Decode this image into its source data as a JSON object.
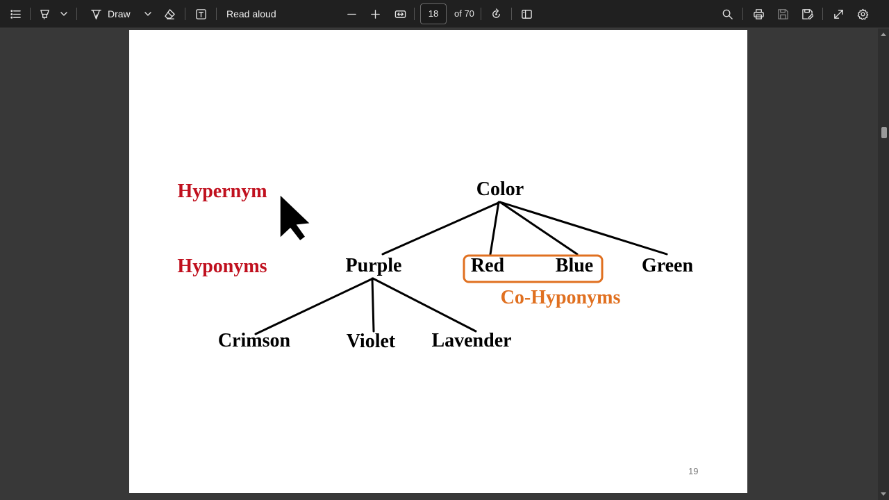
{
  "toolbar": {
    "icons": {
      "contents": "list-icon",
      "highlight": "highlighter-icon",
      "draw": "pen-icon",
      "erase": "eraser-icon",
      "text": "text-box-icon",
      "zoom_out": "minus-icon",
      "zoom_in": "plus-icon",
      "fit": "fit-width-icon",
      "rotate": "rotate-icon",
      "page_view": "page-view-icon",
      "search": "search-icon",
      "print": "print-icon",
      "save": "save-icon",
      "save_as": "save-as-icon",
      "fullscreen": "fullscreen-icon",
      "settings": "gear-icon"
    },
    "draw_label": "Draw",
    "read_aloud_label": "Read aloud",
    "page_number": "18",
    "page_total_text": "of 70"
  },
  "slide": {
    "hypernym_label": "Hypernym",
    "hyponyms_label": "Hyponyms",
    "co_hyponyms_label": "Co-Hyponyms",
    "nodes": {
      "color": "Color",
      "purple": "Purple",
      "red": "Red",
      "blue": "Blue",
      "green": "Green",
      "crimson": "Crimson",
      "violet": "Violet",
      "lavender": "Lavender"
    },
    "page_number": "19",
    "colors": {
      "hypernym": "#c0101e",
      "co_hyponym": "#e07020",
      "box": "#e07020"
    }
  }
}
